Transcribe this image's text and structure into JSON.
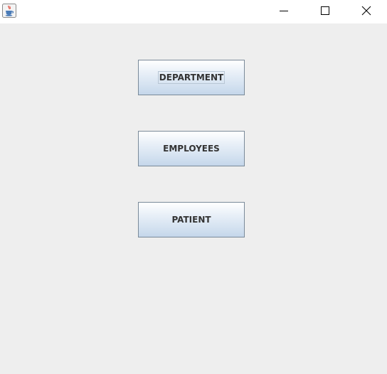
{
  "window": {
    "title": "",
    "icon": "java-cup-icon",
    "controls": {
      "minimize": "minimize-icon",
      "maximize": "maximize-icon",
      "close": "close-icon"
    }
  },
  "buttons": [
    {
      "label": "DEPARTMENT",
      "focused": true
    },
    {
      "label": "EMPLOYEES",
      "focused": false
    },
    {
      "label": "PATIENT",
      "focused": false
    }
  ],
  "colors": {
    "background": "#eeeeee",
    "titlebar": "#ffffff",
    "button_border": "#7a8a99",
    "button_gradient_top": "#ffffff",
    "button_gradient_bottom": "#c4d6ea",
    "text": "#333333"
  }
}
